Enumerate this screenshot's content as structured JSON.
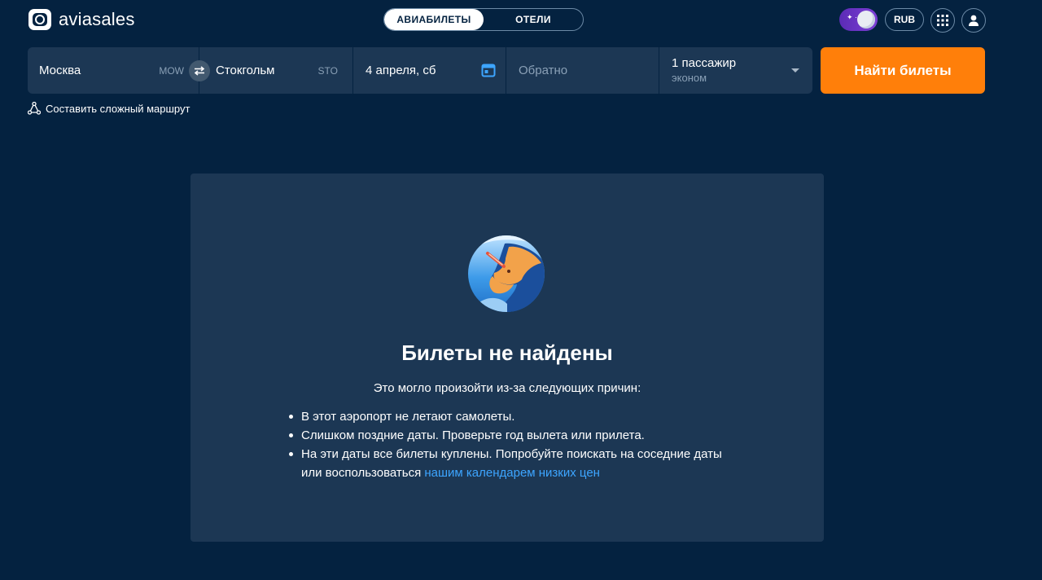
{
  "header": {
    "brand": "aviasales",
    "tabs": [
      {
        "label": "АВИАБИЛЕТЫ",
        "active": true
      },
      {
        "label": "ОТЕЛИ",
        "active": false
      }
    ],
    "currency": "RUB",
    "icons": {
      "theme": "night-mode-toggle",
      "apps": "apps-grid-icon",
      "profile": "user-icon"
    }
  },
  "search": {
    "origin": {
      "city": "Москва",
      "code": "MOW"
    },
    "destination": {
      "city": "Стокгольм",
      "code": "STO"
    },
    "depart_date": "4 апреля, сб",
    "return_placeholder": "Обратно",
    "passengers": "1 пассажир",
    "cabin_class": "эконом",
    "submit_label": "Найти билеты",
    "complex_route_label": "Составить сложный маршрут"
  },
  "empty_state": {
    "title": "Билеты не найдены",
    "subtitle": "Это могло произойти из-за следующих причин:",
    "reasons": [
      "В этот аэропорт не летают самолеты.",
      "Слишком поздние даты. Проверьте год вылета или прилета."
    ],
    "reason3_text": "На эти даты все билеты куплены. Попробуйте поискать на соседние даты или воспользоваться ",
    "reason3_link": "нашим календарем низких цен"
  },
  "colors": {
    "background": "#042240",
    "panel": "#1c3754",
    "accent": "#ff7f0a",
    "link": "#3da5ff",
    "toggle": "#6b35c9"
  }
}
